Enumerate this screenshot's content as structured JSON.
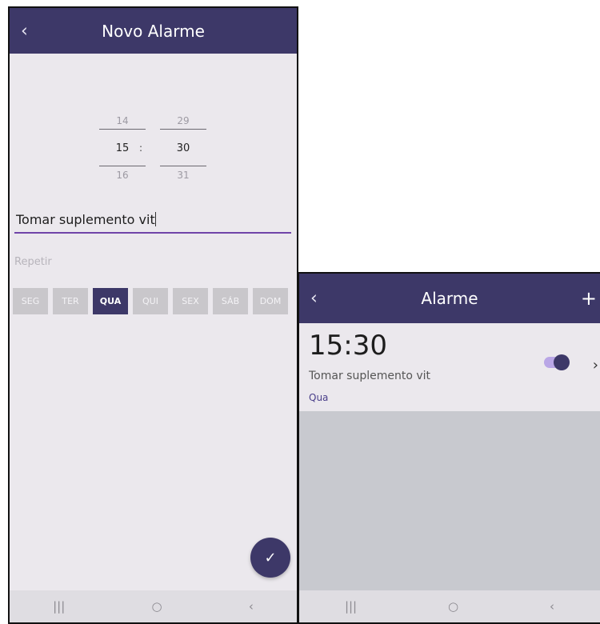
{
  "new_alarm_screen": {
    "title": "Novo Alarme",
    "back_icon": "‹",
    "time_picker": {
      "hours": {
        "prev": "14",
        "selected": "15",
        "next": "16"
      },
      "separator": ":",
      "minutes": {
        "prev": "29",
        "selected": "30",
        "next": "31"
      }
    },
    "title_value": "Tomar suplemento vit",
    "repeat_label": "Repetir",
    "days": [
      {
        "label": "SEG",
        "active": false
      },
      {
        "label": "TER",
        "active": false
      },
      {
        "label": "QUA",
        "active": true
      },
      {
        "label": "QUI",
        "active": false
      },
      {
        "label": "SEX",
        "active": false
      },
      {
        "label": "SÁB",
        "active": false
      },
      {
        "label": "DOM",
        "active": false
      }
    ],
    "confirm_icon": "✓"
  },
  "alarm_list_screen": {
    "title": "Alarme",
    "back_icon": "‹",
    "add_icon": "+",
    "alarm": {
      "time": "15:30",
      "description": "Tomar suplemento vit",
      "days": "Qua",
      "enabled": true
    },
    "chevron_icon": "›"
  },
  "nav": {
    "recents": "|||",
    "home": "○",
    "back": "‹"
  },
  "colors": {
    "primary": "#3d3868",
    "accent_line": "#7044a8",
    "day_inactive": "#c9c7cb",
    "background": "#ebe8ed"
  }
}
